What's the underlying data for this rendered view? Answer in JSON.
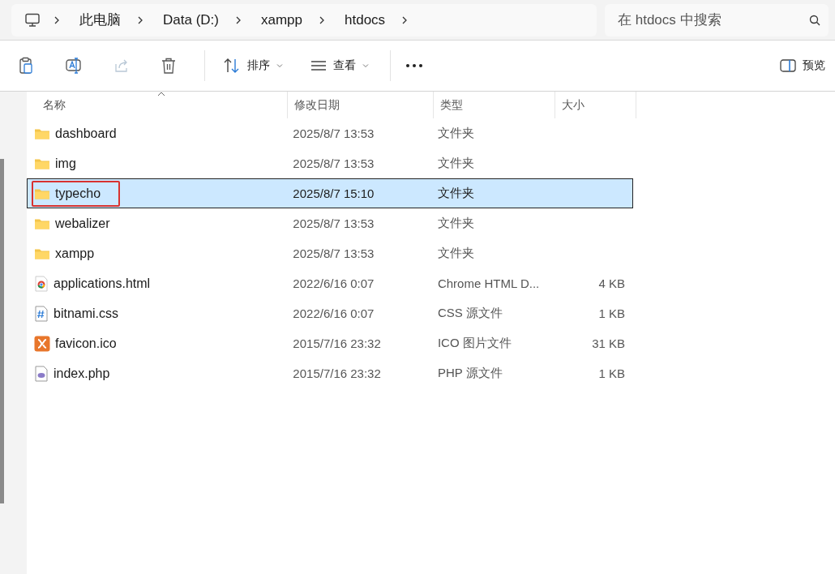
{
  "breadcrumb": [
    "此电脑",
    "Data (D:)",
    "xampp",
    "htdocs"
  ],
  "search": {
    "placeholder": "在 htdocs 中搜索"
  },
  "toolbar": {
    "sort_label": "排序",
    "view_label": "查看",
    "preview_label": "预览"
  },
  "table": {
    "columns": [
      {
        "label": "名称",
        "sorted": true
      },
      {
        "label": "修改日期",
        "sorted": false
      },
      {
        "label": "类型",
        "sorted": false
      },
      {
        "label": "大小",
        "sorted": false
      }
    ],
    "rows": [
      {
        "kind": "folder",
        "name": "dashboard",
        "date": "2025/8/7 13:53",
        "type": "文件夹",
        "size": "",
        "selected": false,
        "annotated": false
      },
      {
        "kind": "folder",
        "name": "img",
        "date": "2025/8/7 13:53",
        "type": "文件夹",
        "size": "",
        "selected": false,
        "annotated": false
      },
      {
        "kind": "folder",
        "name": "typecho",
        "date": "2025/8/7 15:10",
        "type": "文件夹",
        "size": "",
        "selected": true,
        "annotated": true
      },
      {
        "kind": "folder",
        "name": "webalizer",
        "date": "2025/8/7 13:53",
        "type": "文件夹",
        "size": "",
        "selected": false,
        "annotated": false
      },
      {
        "kind": "folder",
        "name": "xampp",
        "date": "2025/8/7 13:53",
        "type": "文件夹",
        "size": "",
        "selected": false,
        "annotated": false
      },
      {
        "kind": "chrome",
        "name": "applications.html",
        "date": "2022/6/16 0:07",
        "type": "Chrome HTML D...",
        "size": "4 KB",
        "selected": false,
        "annotated": false
      },
      {
        "kind": "css",
        "name": "bitnami.css",
        "date": "2022/6/16 0:07",
        "type": "CSS 源文件",
        "size": "1 KB",
        "selected": false,
        "annotated": false
      },
      {
        "kind": "xampp",
        "name": "favicon.ico",
        "date": "2015/7/16 23:32",
        "type": "ICO 图片文件",
        "size": "31 KB",
        "selected": false,
        "annotated": false
      },
      {
        "kind": "php",
        "name": "index.php",
        "date": "2015/7/16 23:32",
        "type": "PHP 源文件",
        "size": "1 KB",
        "selected": false,
        "annotated": false
      }
    ]
  }
}
